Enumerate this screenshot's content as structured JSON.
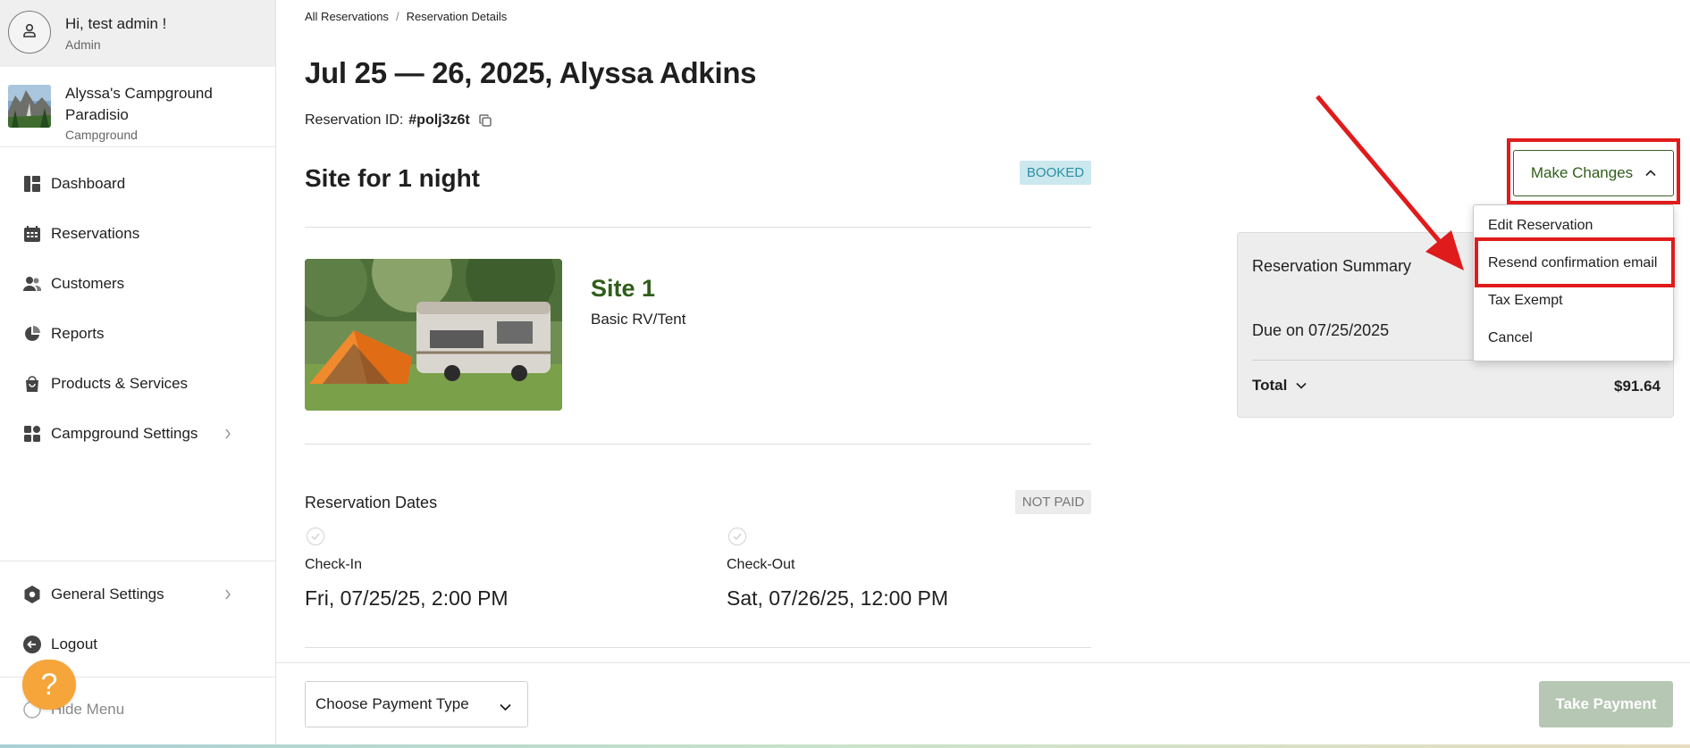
{
  "user": {
    "greeting": "Hi, test admin !",
    "role": "Admin"
  },
  "campground": {
    "name": "Alyssa's Campground Paradisio",
    "type": "Campground"
  },
  "nav": {
    "items": [
      {
        "label": "Dashboard",
        "icon": "dashboard-icon"
      },
      {
        "label": "Reservations",
        "icon": "calendar-icon"
      },
      {
        "label": "Customers",
        "icon": "users-icon"
      },
      {
        "label": "Reports",
        "icon": "pie-chart-icon"
      },
      {
        "label": "Products & Services",
        "icon": "shopping-bag-icon"
      },
      {
        "label": "Campground Settings",
        "icon": "grid-icon"
      }
    ],
    "bottom_items": [
      {
        "label": "General Settings",
        "icon": "hexagon-gear-icon"
      },
      {
        "label": "Logout",
        "icon": "logout-icon"
      },
      {
        "label": "Hide Menu",
        "icon": "hide-menu-icon"
      }
    ]
  },
  "help": {
    "label": "?"
  },
  "breadcrumb": {
    "root": "All Reservations",
    "separator": "/",
    "current": "Reservation Details"
  },
  "page": {
    "title": "Jul 25 — 26, 2025, Alyssa Adkins",
    "res_id_label": "Reservation ID:",
    "res_id_value": "#polj3z6t"
  },
  "site_section": {
    "title": "Site for 1 night",
    "status_badge": "BOOKED",
    "site_name": "Site 1",
    "site_type": "Basic RV/Tent"
  },
  "dates": {
    "title": "Reservation Dates",
    "payment_badge": "NOT PAID",
    "check_in_label": "Check-In",
    "check_in_value": "Fri, 07/25/25, 2:00 PM",
    "check_out_label": "Check-Out",
    "check_out_value": "Sat, 07/26/25, 12:00 PM"
  },
  "actions": {
    "make_changes_label": "Make Changes",
    "menu_items": [
      "Edit Reservation",
      "Resend confirmation email",
      "Tax Exempt",
      "Cancel"
    ]
  },
  "summary": {
    "title": "Reservation Summary",
    "due": "Due on 07/25/2025",
    "total_label": "Total",
    "total_value": "$91.64"
  },
  "bottom_bar": {
    "payment_type_placeholder": "Choose Payment Type",
    "take_payment_label": "Take Payment"
  },
  "colors": {
    "brand_green": "#2f5e1a",
    "booked_bg": "#cbe8ee",
    "booked_text": "#2b8ea4",
    "annotation_red": "#e01b1b",
    "help_orange": "#f6a53a",
    "take_payment_disabled": "#b6c7b4"
  }
}
